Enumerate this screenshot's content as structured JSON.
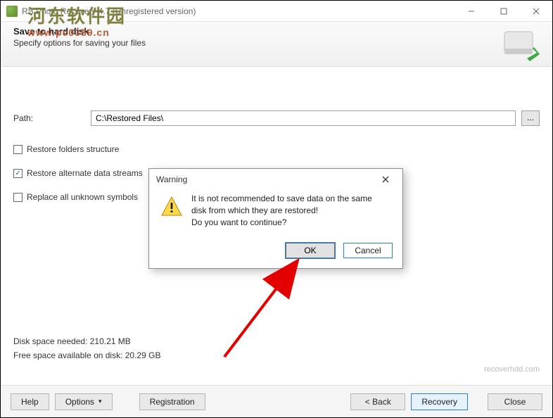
{
  "window": {
    "title": "RS Photo Recovery 4.7 (Unregistered version)"
  },
  "watermark": {
    "text_ch": "河东软件园",
    "url": "www.pc0359.cn"
  },
  "header": {
    "title": "Save to hard disk",
    "subtitle": "Specify options for saving your files"
  },
  "path": {
    "label": "Path:",
    "value": "C:\\Restored Files\\",
    "browse": "..."
  },
  "options": {
    "restore_folders": {
      "label": "Restore folders structure",
      "checked": false
    },
    "restore_ads": {
      "label": "Restore alternate data streams",
      "checked": true
    },
    "replace_unknown": {
      "label": "Replace all unknown symbols",
      "checked": false
    }
  },
  "stats": {
    "needed": "Disk space needed: 210.21 MB",
    "free": "Free space available on disk: 20.29 GB"
  },
  "brand": "recoverhdd.com",
  "footer": {
    "help": "Help",
    "options": "Options",
    "registration": "Registration",
    "back": "< Back",
    "recovery": "Recovery",
    "close": "Close"
  },
  "dialog": {
    "title": "Warning",
    "line1": "It is not recommended to save data on the same",
    "line2": "disk from which they are restored!",
    "line3": "Do you want to continue?",
    "ok": "OK",
    "cancel": "Cancel"
  }
}
